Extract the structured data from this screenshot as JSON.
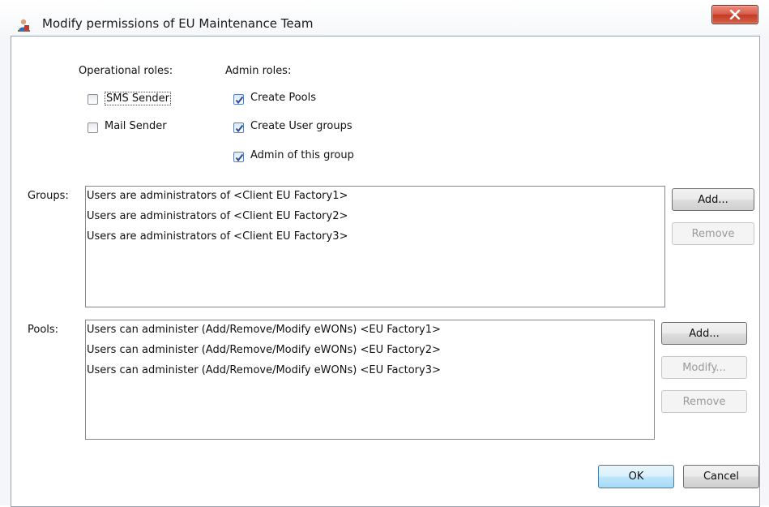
{
  "window": {
    "title": "Modify permissions of EU Maintenance Team",
    "app_icon": "users-icon",
    "close_icon": "close-icon"
  },
  "roles": {
    "operational_title": "Operational roles:",
    "admin_title": "Admin roles:",
    "operational": [
      {
        "label": "SMS Sender",
        "checked": false
      },
      {
        "label": "Mail Sender",
        "checked": false
      }
    ],
    "admin": [
      {
        "label": "Create Pools",
        "checked": true
      },
      {
        "label": "Create User groups",
        "checked": true
      },
      {
        "label": "Admin of this group",
        "checked": true
      }
    ]
  },
  "groups": {
    "label": "Groups:",
    "items": [
      "Users are administrators of  <Client EU Factory1>",
      "Users are administrators of  <Client EU Factory2>",
      "Users are administrators of  <Client EU Factory3>"
    ],
    "buttons": {
      "add": "Add...",
      "remove": "Remove"
    }
  },
  "pools": {
    "label": "Pools:",
    "items": [
      "Users can administer (Add/Remove/Modify  eWONs) <EU Factory1>",
      "Users can administer (Add/Remove/Modify  eWONs) <EU Factory2>",
      "Users can administer (Add/Remove/Modify  eWONs) <EU Factory3>"
    ],
    "buttons": {
      "add": "Add...",
      "modify": "Modify...",
      "remove": "Remove"
    }
  },
  "footer": {
    "ok": "OK",
    "cancel": "Cancel"
  }
}
